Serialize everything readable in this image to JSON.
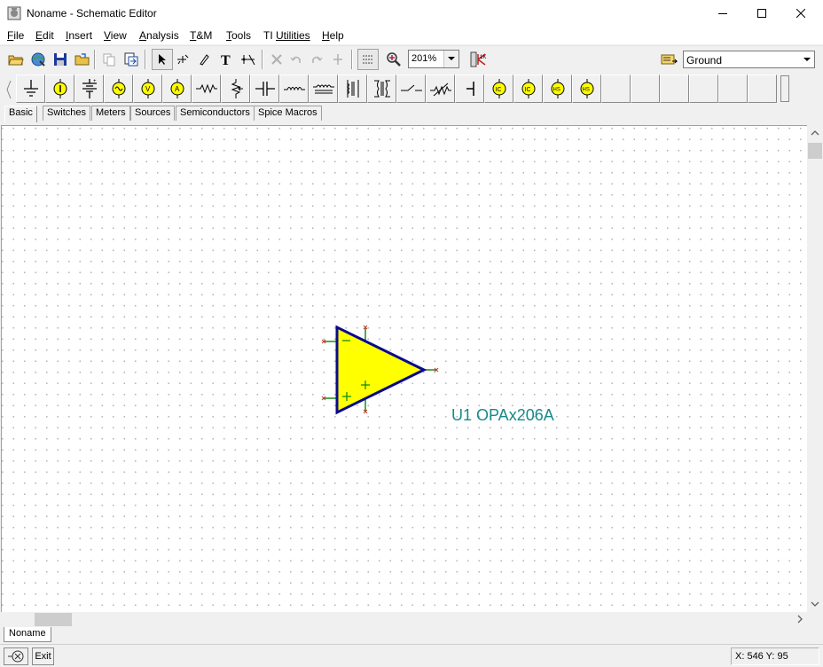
{
  "window": {
    "title": "Noname - Schematic Editor"
  },
  "menu": [
    {
      "label": "File",
      "key": "F",
      "rest": "ile"
    },
    {
      "label": "Edit",
      "key": "E",
      "rest": "dit"
    },
    {
      "label": "Insert",
      "key": "I",
      "rest": "nsert"
    },
    {
      "label": "View",
      "key": "V",
      "rest": "iew"
    },
    {
      "label": "Analysis",
      "key": "A",
      "rest": "nalysis"
    },
    {
      "label": "T&M",
      "key": "T",
      "rest": "&M"
    },
    {
      "label": "Tools",
      "key": "T",
      "rest": "ools"
    },
    {
      "label": "TI Utilities",
      "key": "TI ",
      "rest": "Utilities"
    },
    {
      "label": "Help",
      "key": "H",
      "rest": "elp"
    }
  ],
  "toolbar": {
    "zoom": "201%",
    "component": "Ground"
  },
  "component_tabs": [
    "Basic",
    "Switches",
    "Meters",
    "Sources",
    "Semiconductors",
    "Spice Macros"
  ],
  "active_tab": "Basic",
  "schematic": {
    "part_label": "U1 OPAx206A",
    "minus_sign": "−",
    "plus_sign": "+"
  },
  "sheet_tab": "Noname",
  "statusbar": {
    "exit_label": "Exit",
    "coords": "X: 546  Y: 95"
  },
  "colors": {
    "opamp_fill": "#ffff00",
    "opamp_stroke": "#0a0a8c",
    "pin_color": "#1a8a1a",
    "pin_end": "#c0392b",
    "label_color": "#178a8a"
  }
}
